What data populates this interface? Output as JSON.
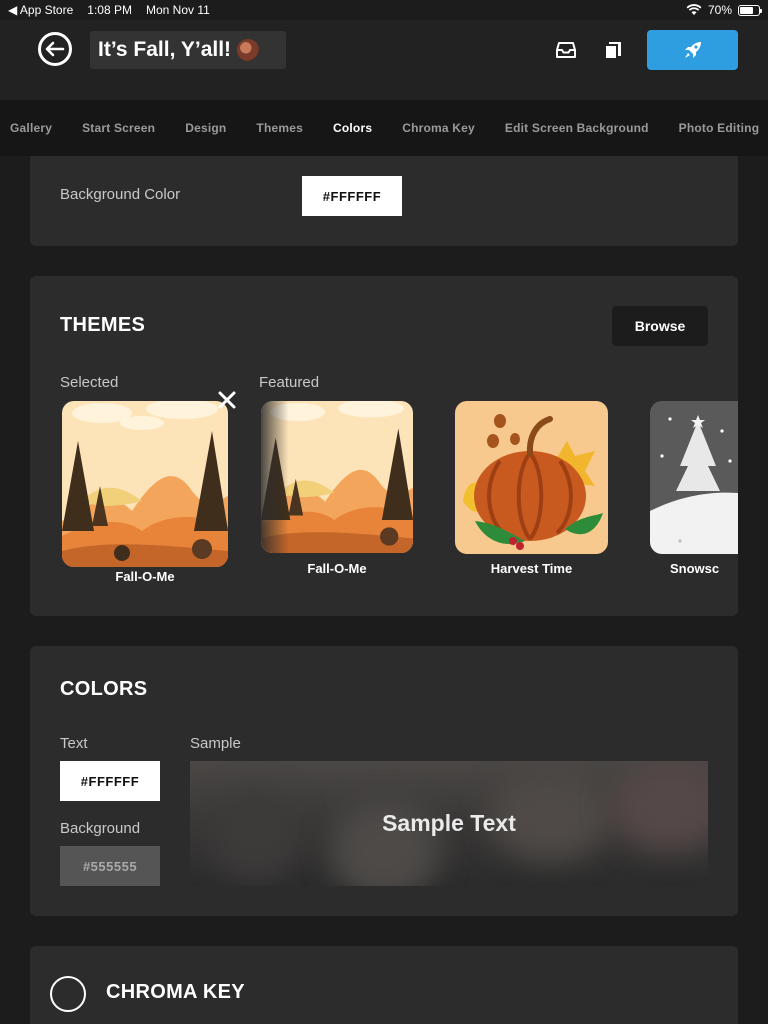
{
  "status_bar": {
    "back_app": "App Store",
    "time": "1:08 PM",
    "date": "Mon Nov 11",
    "battery": "70%",
    "battery_level": 0.7
  },
  "header": {
    "title": "It’s Fall, Y’all!",
    "title_emoji": "turkey-emoji"
  },
  "tabs": [
    {
      "label": "Gallery",
      "active": false
    },
    {
      "label": "Start Screen",
      "active": false
    },
    {
      "label": "Design",
      "active": false
    },
    {
      "label": "Themes",
      "active": false
    },
    {
      "label": "Colors",
      "active": true
    },
    {
      "label": "Chroma Key",
      "active": false
    },
    {
      "label": "Edit Screen Background",
      "active": false
    },
    {
      "label": "Photo Editing",
      "active": false
    }
  ],
  "background_section": {
    "label": "Background Color",
    "value": "#FFFFFF"
  },
  "themes": {
    "title": "THEMES",
    "browse_label": "Browse",
    "selected_label": "Selected",
    "featured_label": "Featured",
    "selected": {
      "name": "Fall-O-Me"
    },
    "featured": [
      {
        "name": "Fall-O-Me"
      },
      {
        "name": "Harvest Time"
      },
      {
        "name": "Snowsc"
      }
    ]
  },
  "colors": {
    "title": "COLORS",
    "text_label": "Text",
    "text_value": "#FFFFFF",
    "background_label": "Background",
    "background_value": "#555555",
    "sample_label": "Sample",
    "sample_text": "Sample Text"
  },
  "chroma_key": {
    "title": "CHROMA KEY"
  },
  "accent_color": "#2f9ee0"
}
